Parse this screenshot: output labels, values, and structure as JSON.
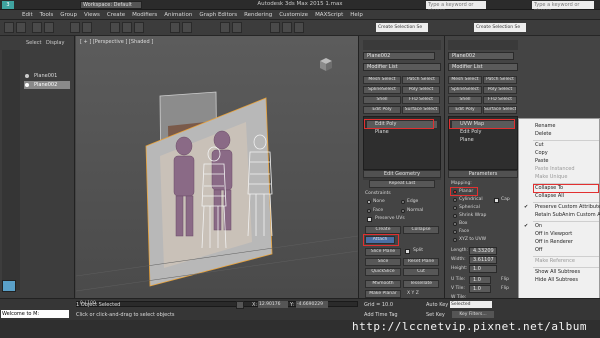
{
  "window": {
    "title": "Autodesk 3ds Max 2015    1.max",
    "workspace": "Workspace: Default",
    "search_placeholder": "Type a keyword or phrase"
  },
  "menu": [
    "Edit",
    "Tools",
    "Group",
    "Views",
    "Create",
    "Modifiers",
    "Animation",
    "Graph Editors",
    "Rendering",
    "Customize",
    "MAXScript",
    "Help"
  ],
  "toolbar": {
    "selection_set_1": "Create Selection Se",
    "selection_set_2": "Create Selection Se"
  },
  "scene_explorer": {
    "tabs": [
      "Select",
      "Display"
    ],
    "items": [
      {
        "label": "Plane001",
        "selected": false
      },
      {
        "label": "Plane002",
        "selected": true
      }
    ]
  },
  "viewport": {
    "label": "[ + ] [Perspective ] [Shaded ]"
  },
  "panel1": {
    "object_name": "Plane002",
    "modifier_list": "Modifier List",
    "buttons": [
      "Mesh Select",
      "Patch Select",
      "SplineSelect",
      "Poly Select",
      "Shell",
      "FFD Select",
      "Edit Poly",
      "Surface Select"
    ],
    "stack": [
      "Edit Poly",
      "Plane"
    ],
    "rollout": "Edit Geometry",
    "repeat_last": "Repeat Last",
    "constraints_label": "Constraints",
    "constraints": [
      "None",
      "Edge",
      "Face",
      "Normal"
    ],
    "preserve_uvs": "Preserve UVs",
    "create": "Create",
    "collapse": "Collapse",
    "attach": "Attach",
    "slice_plane": "Slice Plane",
    "split": "Split",
    "slice": "Slice",
    "reset_plane": "Reset Plane",
    "quickslice": "QuickSlice",
    "cut": "Cut",
    "msmooth": "MSmooth",
    "tessellate": "Tessellate",
    "make_planar": "Make Planar",
    "xyz": "X Y Z"
  },
  "panel2": {
    "object_name": "Plane002",
    "modifier_list": "Modifier List",
    "buttons": [
      "Mesh Select",
      "Patch Select",
      "SplineSelect",
      "Poly Select",
      "Shell",
      "FFD Select",
      "Edit Poly",
      "Surface Select"
    ],
    "stack": [
      "UVW Map",
      "Edit Poly",
      "Plane"
    ],
    "rollout": "Parameters",
    "mapping_label": "Mapping:",
    "mappings": [
      "Planar",
      "Cylindrical",
      "Spherical",
      "Shrink Wrap",
      "Box",
      "Face",
      "XYZ to UVW"
    ],
    "cap": "Cap",
    "length_label": "Length:",
    "length_value": "4.33209",
    "width_label": "Width:",
    "width_value": "3.61107",
    "height_label": "Height:",
    "height_value": "1.0",
    "u_tile_label": "U Tile:",
    "u_tile_value": "1.0",
    "v_tile_label": "V Tile:",
    "v_tile_value": "1.0",
    "w_tile_label": "W Tile:",
    "w_tile_value": "1.0",
    "flip": "Flip"
  },
  "context_menu": {
    "items": [
      {
        "label": "Rename",
        "disabled": false,
        "checked": false,
        "highlight": false
      },
      {
        "label": "Delete",
        "disabled": false,
        "checked": false,
        "highlight": false
      },
      {
        "sep": true
      },
      {
        "label": "Cut",
        "disabled": false,
        "checked": false,
        "highlight": false
      },
      {
        "label": "Copy",
        "disabled": false,
        "checked": false,
        "highlight": false
      },
      {
        "label": "Paste",
        "disabled": false,
        "checked": false,
        "highlight": false
      },
      {
        "label": "Paste Instanced",
        "disabled": true,
        "checked": false,
        "highlight": false
      },
      {
        "label": "Make Unique",
        "disabled": true,
        "checked": false,
        "highlight": false
      },
      {
        "sep": true
      },
      {
        "label": "Collapse To",
        "disabled": false,
        "checked": false,
        "highlight": true
      },
      {
        "label": "Collapse All",
        "disabled": false,
        "checked": false,
        "highlight": false
      },
      {
        "sep": true
      },
      {
        "label": "Preserve Custom Attributes",
        "disabled": false,
        "checked": true,
        "highlight": false
      },
      {
        "label": "Retain SubAnim Custom Attr",
        "disabled": false,
        "checked": false,
        "highlight": false
      },
      {
        "sep": true
      },
      {
        "label": "On",
        "disabled": false,
        "checked": true,
        "highlight": false
      },
      {
        "label": "Off in Viewport",
        "disabled": false,
        "checked": false,
        "highlight": false
      },
      {
        "label": "Off in Renderer",
        "disabled": false,
        "checked": false,
        "highlight": false
      },
      {
        "label": "Off",
        "disabled": false,
        "checked": false,
        "highlight": false
      },
      {
        "sep": true
      },
      {
        "label": "Make Reference",
        "disabled": true,
        "checked": false,
        "highlight": false
      },
      {
        "sep": true
      },
      {
        "label": "Show All Subtrees",
        "disabled": false,
        "checked": false,
        "highlight": false
      },
      {
        "label": "Hide All Subtrees",
        "disabled": false,
        "checked": false,
        "highlight": false
      }
    ]
  },
  "status": {
    "selection": "1 Object Selected",
    "prompt": "Click or click-and-drag to select objects",
    "frame": "0 / 100",
    "x_label": "X:",
    "x_value": "12.90176",
    "y_label": "Y:",
    "y_value": "-4.6690229",
    "grid": "Grid = 10.0",
    "auto_key": "Auto Key",
    "selected": "Selected",
    "add_time_tag": "Add Time Tag",
    "set_key": "Set Key",
    "key_filters": "Key Filters...",
    "welcome": "Welcome to M:",
    "watermark": "http://lccnetvip.pixnet.net/album"
  }
}
